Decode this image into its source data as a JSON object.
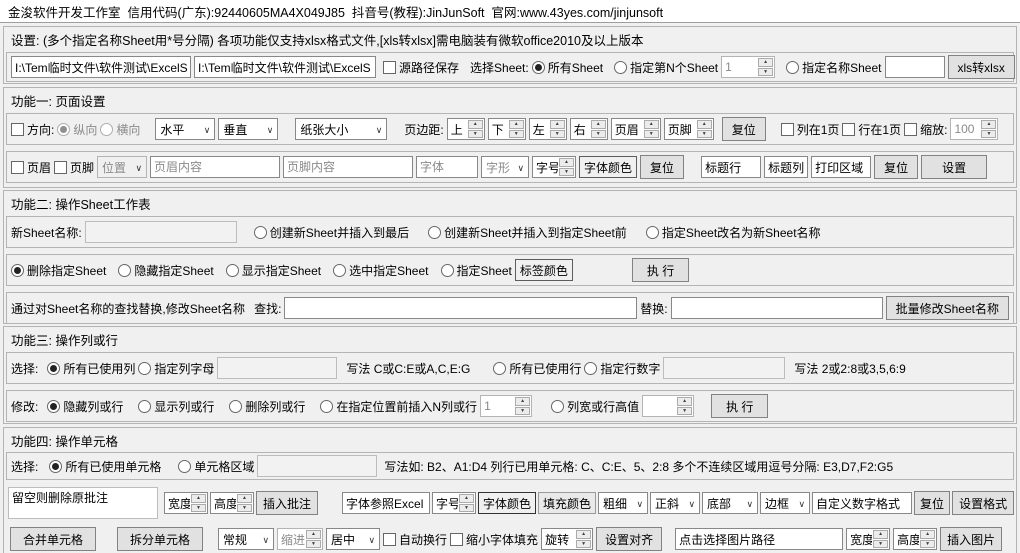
{
  "colors": {
    "window_bg": "#f0f0f0",
    "titlebar_bg": "#ffffff",
    "button_bg": "#e1e1e1",
    "border": "#b4b4b4"
  },
  "titlebar": {
    "text": "金浚软件开发工作室  信用代码(广东):92440605MA4X049J85  抖音号(教程):JinJunSoft  官网:www.43yes.com/jinjunsoft"
  },
  "common": {
    "reset": "复位",
    "execute": "执 行",
    "width": "宽度",
    "height": "高度",
    "font_size": "字号",
    "font_color": "字体颜色"
  },
  "settings": {
    "title": "设置:  (多个指定名称Sheet用*号分隔)  各项功能仅支持xlsx格式文件,[xls转xlsx]需电脑装有微软office2010及以上版本",
    "source_path": "I:\\Tem临时文件\\软件测试\\ExcelS",
    "target_path": "I:\\Tem临时文件\\软件测试\\ExcelS",
    "keep_source_path": "源路径保存",
    "select_sheet": "选择Sheet:",
    "all_sheets": "所有Sheet",
    "nth_sheet": "指定第N个Sheet",
    "nth_value": "1",
    "named_sheet": "指定名称Sheet",
    "xls_to_xlsx": "xls转xlsx"
  },
  "func1": {
    "title": "功能一: 页面设置",
    "direction": "方向:",
    "portrait": "纵向",
    "landscape": "横向",
    "h_align": "水平",
    "v_align": "垂直",
    "paper": "纸张大小",
    "margins": "页边距:",
    "top": "上",
    "bottom": "下",
    "left": "左",
    "right": "右",
    "header": "页眉",
    "footer": "页脚",
    "fit_cols": "列在1页",
    "fit_rows": "行在1页",
    "scale": "缩放:",
    "scale_value": "100",
    "position": "位置",
    "header_content": "页眉内容",
    "footer_content": "页脚内容",
    "font": "字体",
    "font_style": "字形",
    "title_row": "标题行",
    "title_col": "标题列",
    "print_area": "打印区域",
    "set": "设置"
  },
  "func2": {
    "title": "功能二: 操作Sheet工作表",
    "new_name": "新Sheet名称:",
    "create_end": "创建新Sheet并插入到最后",
    "create_before": "创建新Sheet并插入到指定Sheet前",
    "rename_to": "指定Sheet改名为新Sheet名称",
    "del": "删除指定Sheet",
    "hide": "隐藏指定Sheet",
    "show": "显示指定Sheet",
    "select": "选中指定Sheet",
    "tab": "指定Sheet",
    "tab_color": "标签颜色",
    "find_desc": "通过对Sheet名称的查找替换,修改Sheet名称",
    "find": "查找:",
    "replace": "替换:",
    "batch_rename": "批量修改Sheet名称"
  },
  "func3": {
    "title": "功能三: 操作列或行",
    "select": "选择:",
    "all_cols": "所有已使用列",
    "col_letter": "指定列字母",
    "col_hint": "写法 C或C:E或A,C,E:G",
    "all_rows": "所有已使用行",
    "row_num": "指定行数字",
    "row_hint": "写法 2或2:8或3,5,6:9",
    "modify": "修改:",
    "hide": "隐藏列或行",
    "show": "显示列或行",
    "del": "删除列或行",
    "insert_n": "在指定位置前插入N列或行",
    "insert_value": "1",
    "size_value": "列宽或行高值"
  },
  "func4": {
    "title": "功能四: 操作单元格",
    "select": "选择:",
    "all_cells": "所有已使用单元格",
    "range": "单元格区域",
    "range_hint": "写法如:  B2、A1:D4  列行已用单元格:  C、C:E、5、2:8  多个不连续区域用逗号分隔:  E3,D7,F2:G5",
    "comment_note": "留空则删除原批注",
    "insert_comment": "插入批注",
    "font_ref": "字体参照Excel",
    "fill_color": "填充颜色",
    "bold": "粗细",
    "italic": "正斜",
    "vpos": "底部",
    "border": "边框",
    "num_format": "自定义数字格式",
    "set_format": "设置格式",
    "merge": "合并单元格",
    "split": "拆分单元格",
    "general": "常规",
    "indent": "缩进",
    "center": "居中",
    "wrap": "自动换行",
    "shrink": "缩小字体填充",
    "rotate": "旋转",
    "set_align": "设置对齐",
    "img_path": "点击选择图片路径",
    "insert_img": "插入图片"
  }
}
